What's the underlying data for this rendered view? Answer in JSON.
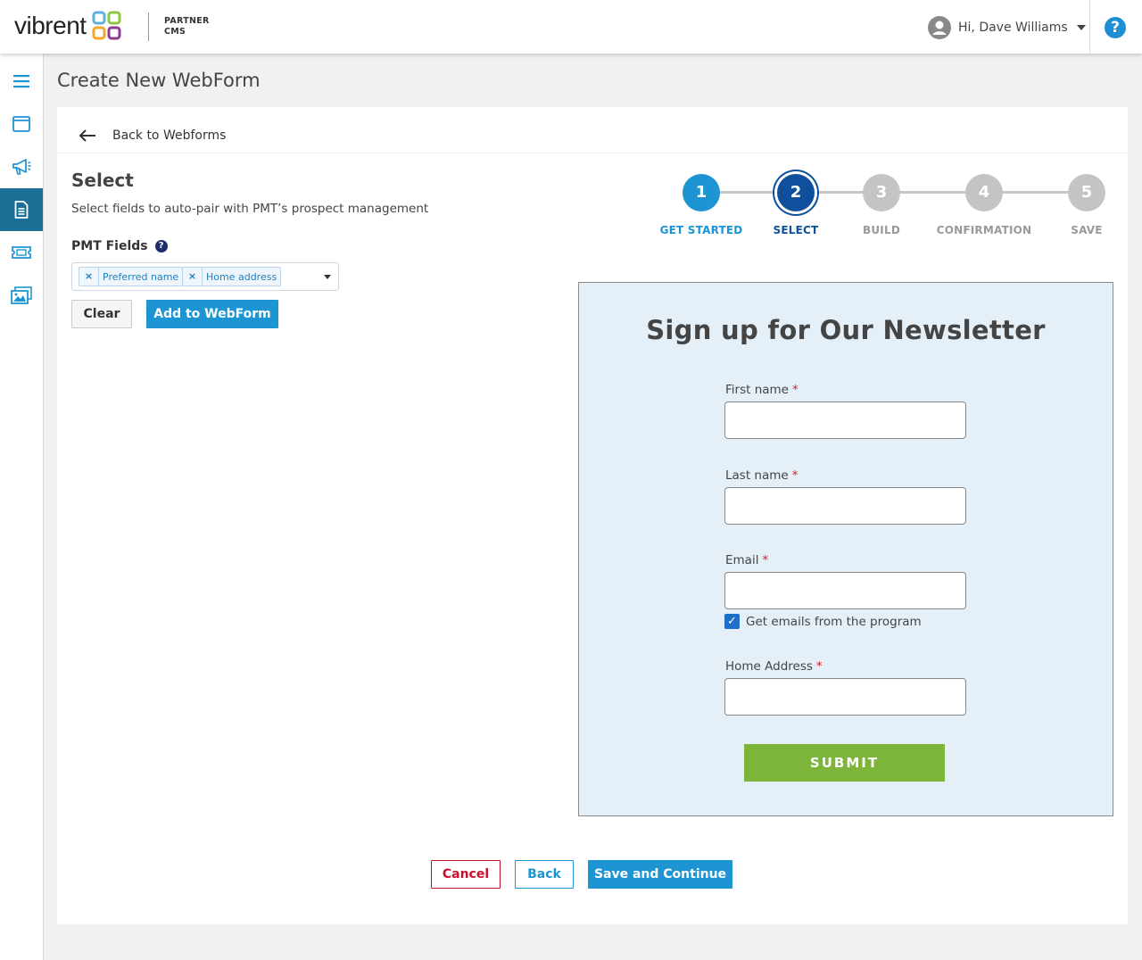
{
  "brand": {
    "name": "vibrent",
    "sub_line1": "PARTNER",
    "sub_line2": "CMS"
  },
  "header": {
    "greeting": "Hi, Dave Williams",
    "help_symbol": "?"
  },
  "sidebar": {
    "items": [
      {
        "icon": "menu-icon",
        "active": false
      },
      {
        "icon": "browser-window-icon",
        "active": false
      },
      {
        "icon": "megaphone-icon",
        "active": false
      },
      {
        "icon": "document-icon",
        "active": true
      },
      {
        "icon": "ticket-icon",
        "active": false
      },
      {
        "icon": "image-gallery-icon",
        "active": false
      }
    ]
  },
  "page": {
    "title": "Create New WebForm",
    "back_label": "Back to Webforms"
  },
  "select": {
    "title": "Select",
    "subtitle": "Select fields to auto-pair with PMT’s prospect management",
    "fields_label": "PMT Fields",
    "help_symbol": "?",
    "chips": [
      "Preferred name",
      "Home address"
    ],
    "remove_symbol": "×",
    "clear_label": "Clear",
    "add_label": "Add to WebForm"
  },
  "stepper": {
    "steps": [
      {
        "num": "1",
        "label": "GET STARTED",
        "state": "done"
      },
      {
        "num": "2",
        "label": "SELECT",
        "state": "active"
      },
      {
        "num": "3",
        "label": "BUILD",
        "state": "pending"
      },
      {
        "num": "4",
        "label": "CONFIRMATION",
        "state": "pending"
      },
      {
        "num": "5",
        "label": "SAVE",
        "state": "pending"
      }
    ]
  },
  "preview": {
    "title": "Sign up for Our Newsletter",
    "required_marker": "*",
    "fields": [
      "First name",
      "Last name",
      "Email",
      "Home Address"
    ],
    "checkbox_label": "Get emails from the program",
    "checkbox_checked": true,
    "checkbox_mark": "✓",
    "submit_label": "SUBMIT"
  },
  "footer": {
    "cancel_label": "Cancel",
    "back_label": "Back",
    "save_label": "Save and Continue"
  },
  "colors": {
    "accent": "#1e95d3",
    "active_step": "#0f4f9c",
    "sidebar_active": "#1b6e96",
    "submit": "#7db53a",
    "cancel": "#c8102e",
    "preview_bg": "#e5eff8"
  }
}
